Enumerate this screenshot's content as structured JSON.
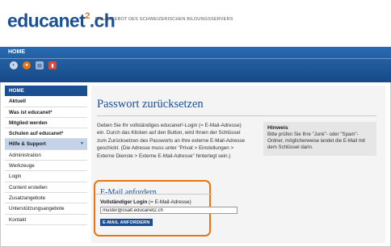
{
  "header": {
    "logo_main": "educanet",
    "logo_sup": "2",
    "logo_tld": ".ch",
    "tagline": "EIN ANGEBOT DES SCHWEIZERISCHEN BILDUNGSSERVERS"
  },
  "topbar": {
    "home_tab": "HOME",
    "icons": [
      "globe-icon",
      "settings-icon",
      "document-icon",
      "dictionary-icon"
    ]
  },
  "sidebar": {
    "items": [
      {
        "label": "HOME",
        "type": "head"
      },
      {
        "label": "Aktuell",
        "type": "bold"
      },
      {
        "label": "Was ist educanet²",
        "type": "bold"
      },
      {
        "label": "Mitglied werden",
        "type": "bold"
      },
      {
        "label": "Schulen auf educanet²",
        "type": "bold"
      },
      {
        "label": "Hilfe & Support",
        "type": "section"
      },
      {
        "label": "Administration",
        "type": "sub"
      },
      {
        "label": "Werkzeuge",
        "type": "sub"
      },
      {
        "label": "Login",
        "type": "sub"
      },
      {
        "label": "Content erstellen",
        "type": "sub"
      },
      {
        "label": "Zusatzangebote",
        "type": "sub"
      },
      {
        "label": "Unterstützungsangebote",
        "type": "sub"
      },
      {
        "label": "Kontakt",
        "type": "sub"
      }
    ]
  },
  "main": {
    "title": "Passwort zurücksetzen",
    "intro": "Geben Sie Ihr vollständiges educanet²-Login (= E-Mail-Adresse) ein. Durch das Klicken auf den Button, wird Ihnen der Schlüssel zum Zurücksetzen des Passworts an Ihre externe E-Mail-Adresse geschickt. (Die Adresse muss unter \"Privat > Einstellungen > Externe Dienste > Externe E-Mail-Adresse\" hinterlegt sein.)",
    "hint": {
      "title": "Hinweis",
      "text": "Bitte prüfen Sie Ihre \"Junk\"- oder \"Spam\"-Ordner, möglicherweise landet die E-Mail mit dem Schlüssel darin."
    },
    "form": {
      "heading": "E-Mail anfordern",
      "label_bold": "Vollständiger Login",
      "label_rest": " (= E-Mail-Adresse)",
      "input_value": "muster@osalt.educanet2.ch",
      "submit_label": "E-MAIL ANFORDERN"
    }
  },
  "colors": {
    "brand_blue": "#1b4f93",
    "accent_orange": "#e87511",
    "panel_gray": "#f4f4f4"
  }
}
